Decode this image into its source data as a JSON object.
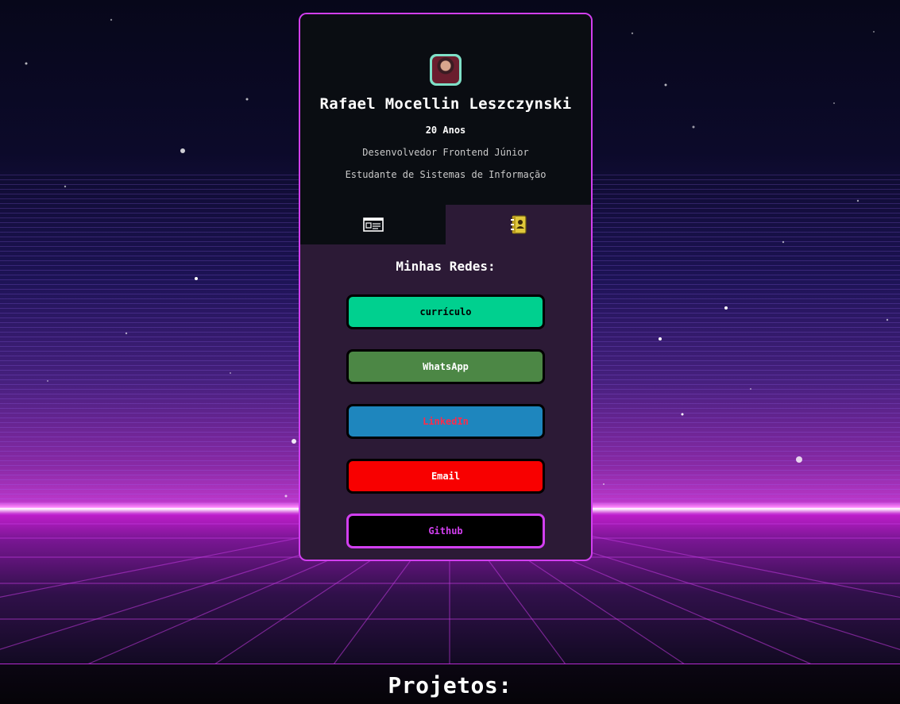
{
  "profile": {
    "name": "Rafael Mocellin Leszczynski",
    "age": "20 Anos",
    "role": "Desenvolvedor Frontend Júnior",
    "study": "Estudante de Sistemas de Informação",
    "avatar_icon": "profile-photo"
  },
  "tabs": [
    {
      "icon": "card-info-icon",
      "active": false
    },
    {
      "icon": "contact-book-icon",
      "active": true
    }
  ],
  "networks": {
    "title": "Minhas Redes:",
    "buttons": [
      {
        "label": "currículo",
        "bg": "#00d08f",
        "color": "#000000"
      },
      {
        "label": "WhatsApp",
        "bg": "#4c8745",
        "color": "#ffffff"
      },
      {
        "label": "LinkedIn",
        "bg": "#1e86be",
        "color": "#ff2b4a"
      },
      {
        "label": "Email",
        "bg": "#f80000",
        "color": "#ffffff"
      },
      {
        "label": "Github",
        "bg": "#000000",
        "color": "#d23ff0"
      }
    ]
  },
  "footer": {
    "title": "Projetos:"
  },
  "colors": {
    "accent": "#d23ff0",
    "card_top": "#0a0d12",
    "card_bottom": "#2c1a36",
    "avatar_border": "#7fe0c7"
  }
}
